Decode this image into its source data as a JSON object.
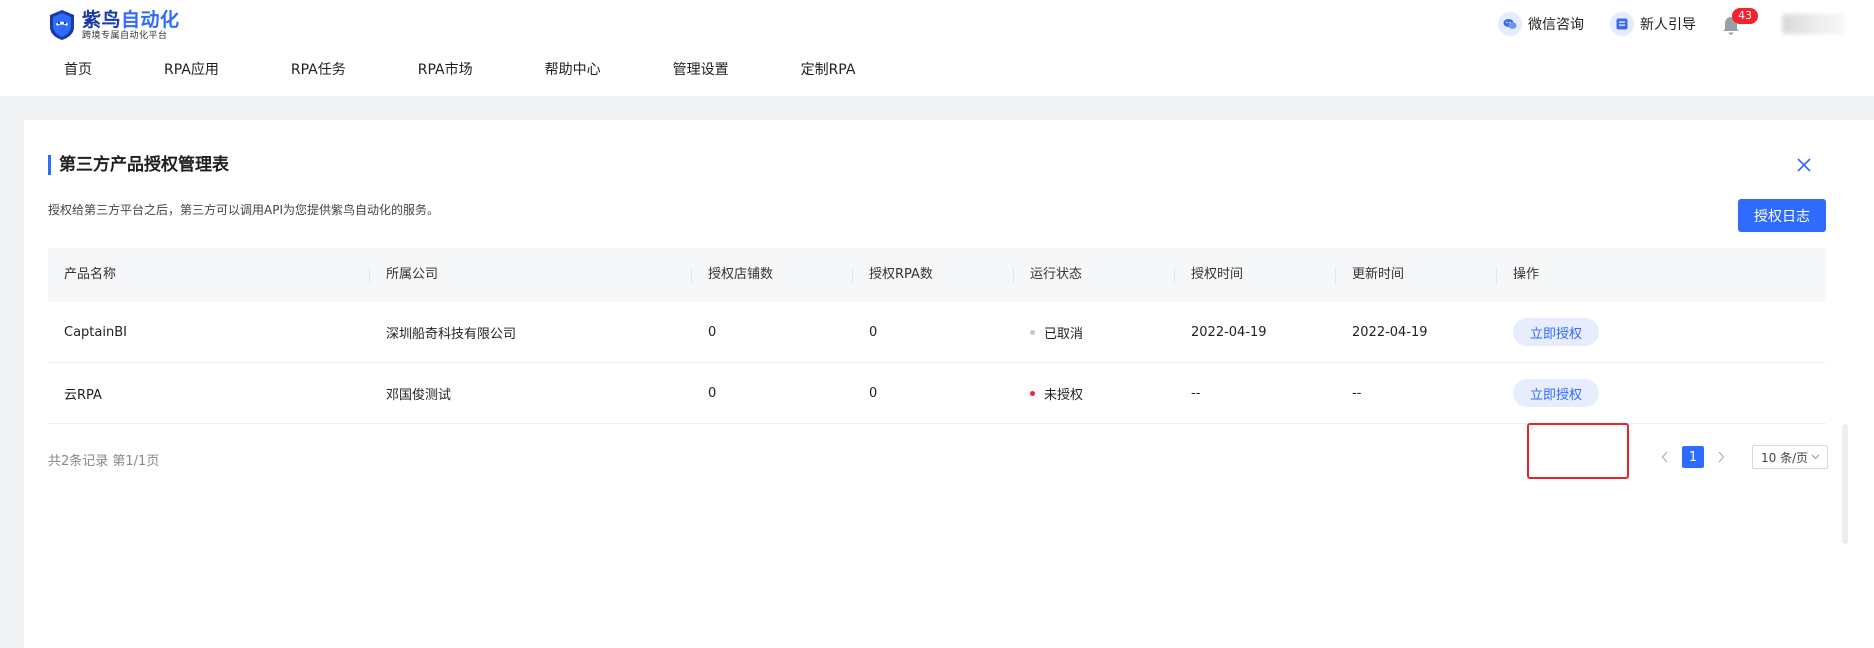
{
  "brand": {
    "title_main": "紫鸟",
    "title_accent": "自动化",
    "subtitle": "跨境专属自动化平台",
    "primary_color": "#2f6bff"
  },
  "nav": {
    "items": [
      {
        "label": "首页"
      },
      {
        "label": "RPA应用"
      },
      {
        "label": "RPA任务"
      },
      {
        "label": "RPA市场"
      },
      {
        "label": "帮助中心"
      },
      {
        "label": "管理设置"
      },
      {
        "label": "定制RPA"
      }
    ]
  },
  "header_actions": {
    "wechat_label": "微信咨询",
    "wechat_icon": "wechat-icon",
    "guide_label": "新人引导",
    "guide_icon": "guide-icon",
    "notification_count": "43",
    "notification_icon": "bell-icon"
  },
  "panel": {
    "title": "第三方产品授权管理表",
    "description": "授权给第三方平台之后，第三方可以调用API为您提供紫鸟自动化的服务。",
    "log_button_label": "授权日志",
    "close_icon": "close-icon"
  },
  "table": {
    "headers": [
      "产品名称",
      "所属公司",
      "授权店铺数",
      "授权RPA数",
      "运行状态",
      "授权时间",
      "更新时间",
      "操作"
    ],
    "rows": [
      {
        "product": "CaptainBI",
        "company": "深圳船奇科技有限公司",
        "store_count": "0",
        "rpa_count": "0",
        "status": "已取消",
        "status_color": "#c8c8c8",
        "auth_time": "2022-04-19",
        "update_time": "2022-04-19",
        "action": "立即授权"
      },
      {
        "product": "云RPA",
        "company": "邓国俊测试",
        "store_count": "0",
        "rpa_count": "0",
        "status": "未授权",
        "status_color": "#f5222d",
        "auth_time": "--",
        "update_time": "--",
        "action": "立即授权"
      }
    ]
  },
  "pagination": {
    "summary": "共2条记录 第1/1页",
    "current_page": "1",
    "page_size_label": "10 条/页"
  }
}
